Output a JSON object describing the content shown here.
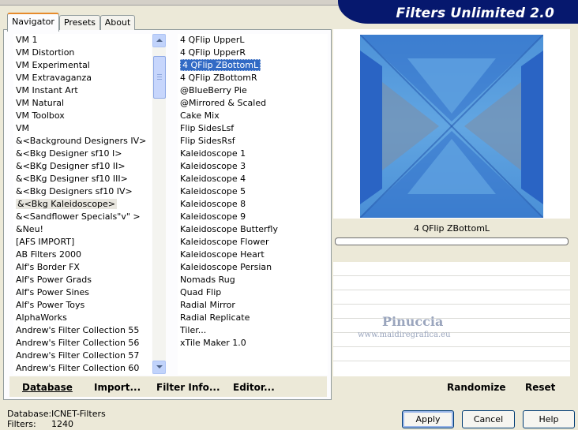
{
  "window": {
    "title": "Filters Unlimited 2.0"
  },
  "tabs": [
    {
      "label": "Navigator"
    },
    {
      "label": "Presets"
    },
    {
      "label": "About"
    }
  ],
  "categories": [
    "VM 1",
    "VM Distortion",
    "VM Experimental",
    "VM Extravaganza",
    "VM Instant Art",
    "VM Natural",
    "VM Toolbox",
    "VM",
    "&<Background Designers IV>",
    "&<Bkg Designer sf10 I>",
    "&<BKg Designer sf10 II>",
    "&<BKg Designer sf10 III>",
    "&<Bkg Designers sf10 IV>",
    "&<Bkg Kaleidoscope>",
    "&<Sandflower Specials\"v\" >",
    "&Neu!",
    "[AFS IMPORT]",
    "AB Filters 2000",
    "Alf's Border FX",
    "Alf's Power Grads",
    "Alf's Power Sines",
    "Alf's Power Toys",
    "AlphaWorks",
    "Andrew's Filter Collection 55",
    "Andrew's Filter Collection 56",
    "Andrew's Filter Collection 57",
    "Andrew's Filter Collection 60"
  ],
  "selected_category": "&<Bkg Kaleidoscope>",
  "filters": [
    "4 QFlip UpperL",
    "4 QFlip UpperR",
    "4 QFlip ZBottomL",
    "4 QFlip ZBottomR",
    "@BlueBerry Pie",
    "@Mirrored & Scaled",
    "Cake Mix",
    "Flip SidesLsf",
    "Flip SidesRsf",
    "Kaleidoscope 1",
    "Kaleidoscope 3",
    "Kaleidoscope 4",
    "Kaleidoscope 5",
    "Kaleidoscope 8",
    "Kaleidoscope 9",
    "Kaleidoscope Butterfly",
    "Kaleidoscope Flower",
    "Kaleidoscope Heart",
    "Kaleidoscope Persian",
    "Nomads Rug",
    "Quad Flip",
    "Radial Mirror",
    "Radial Replicate",
    "Tiler...",
    "xTile Maker 1.0"
  ],
  "selected_filter": "4 QFlip ZBottomL",
  "toolbar": {
    "database": "Database",
    "import": "Import...",
    "filter_info": "Filter Info...",
    "editor": "Editor...",
    "randomize": "Randomize",
    "reset": "Reset"
  },
  "preview": {
    "filter_name": "4 QFlip ZBottomL"
  },
  "watermark": {
    "name": "Pinuccia",
    "url": "www.maidiregrafica.eu"
  },
  "status": {
    "database_label": "Database:",
    "database_value": "ICNET-Filters",
    "filters_label": "Filters:",
    "filters_value": "1240"
  },
  "buttons": {
    "apply": "Apply",
    "cancel": "Cancel",
    "help": "Help"
  },
  "colors": {
    "banner": "#06186e",
    "selection": "#316ac5",
    "tab_accent": "#e68b2c"
  }
}
